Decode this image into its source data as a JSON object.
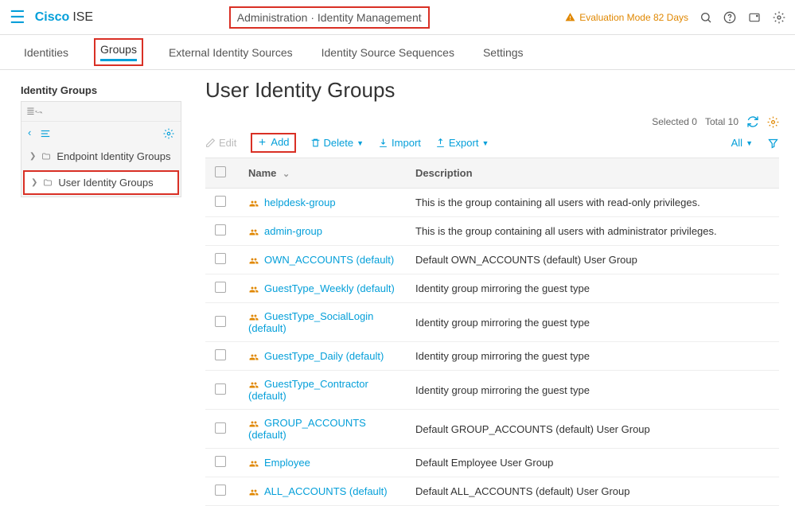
{
  "header": {
    "brand": "Cisco",
    "product": "ISE",
    "breadcrumb": "Administration · Identity Management",
    "eval_text": "Evaluation Mode 82 Days"
  },
  "tabs": {
    "identities": "Identities",
    "groups": "Groups",
    "ext_sources": "External Identity Sources",
    "seq": "Identity Source Sequences",
    "settings": "Settings"
  },
  "sidebar": {
    "title": "Identity Groups",
    "tree": {
      "endpoint": "Endpoint Identity Groups",
      "user": "User Identity Groups"
    }
  },
  "page": {
    "title": "User Identity Groups",
    "selected_label": "Selected 0",
    "total_label": "Total 10"
  },
  "toolbar": {
    "edit": "Edit",
    "add": "Add",
    "delete": "Delete",
    "import": "Import",
    "export": "Export",
    "all": "All"
  },
  "columns": {
    "name": "Name",
    "description": "Description"
  },
  "rows": [
    {
      "name": "helpdesk-group",
      "desc": "This is the group containing all users with read-only privileges."
    },
    {
      "name": "admin-group",
      "desc": "This is the group containing all users with administrator privileges."
    },
    {
      "name": "OWN_ACCOUNTS (default)",
      "desc": "Default OWN_ACCOUNTS (default) User Group"
    },
    {
      "name": "GuestType_Weekly (default)",
      "desc": "Identity group mirroring the guest type"
    },
    {
      "name": "GuestType_SocialLogin (default)",
      "desc": "Identity group mirroring the guest type"
    },
    {
      "name": "GuestType_Daily (default)",
      "desc": "Identity group mirroring the guest type"
    },
    {
      "name": "GuestType_Contractor (default)",
      "desc": "Identity group mirroring the guest type"
    },
    {
      "name": "GROUP_ACCOUNTS (default)",
      "desc": "Default GROUP_ACCOUNTS (default) User Group"
    },
    {
      "name": "Employee",
      "desc": "Default Employee User Group"
    },
    {
      "name": "ALL_ACCOUNTS (default)",
      "desc": "Default ALL_ACCOUNTS (default) User Group"
    }
  ]
}
